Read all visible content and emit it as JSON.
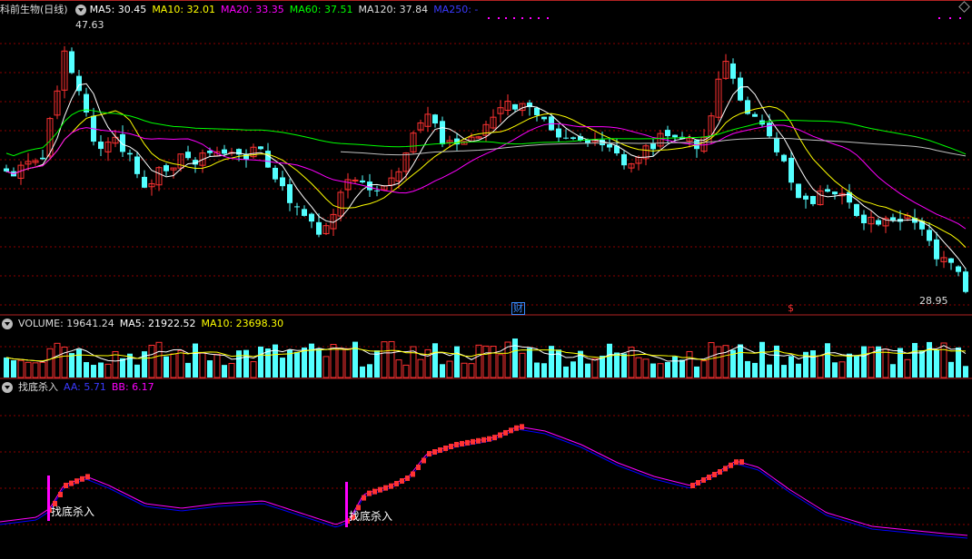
{
  "header": {
    "stock_name": "科前生物(日线)",
    "ma5": "MA5: 30.45",
    "ma10": "MA10: 32.01",
    "ma20": "MA20: 33.35",
    "ma60": "MA60: 37.51",
    "ma120": "MA120: 37.84",
    "ma250": "MA250: -"
  },
  "price_panel": {
    "high_label": "47.63",
    "low_label": "28.95",
    "event_marker_1": "财",
    "event_marker_2": "$"
  },
  "volume_header": {
    "volume": "VOLUME: 19641.24",
    "ma5": "MA5: 21922.52",
    "ma10": "MA10: 23698.30"
  },
  "indicator_header": {
    "name": "找底杀入",
    "aa": "AA: 5.71",
    "bb": "BB: 6.17"
  },
  "indicator_panel": {
    "signal_label_1": "找底杀入",
    "signal_label_2": "找底杀入"
  },
  "colors": {
    "up": "#ff3232",
    "down": "#54ffff",
    "ma5": "#ffffff",
    "ma10": "#ffff00",
    "ma20": "#ff00ff",
    "ma60": "#00ff00",
    "ma120": "#c0c0c0",
    "ma250": "#0000ff",
    "aa": "#0000ff",
    "bb": "#ff00ff",
    "grid": "#8b0000"
  }
}
